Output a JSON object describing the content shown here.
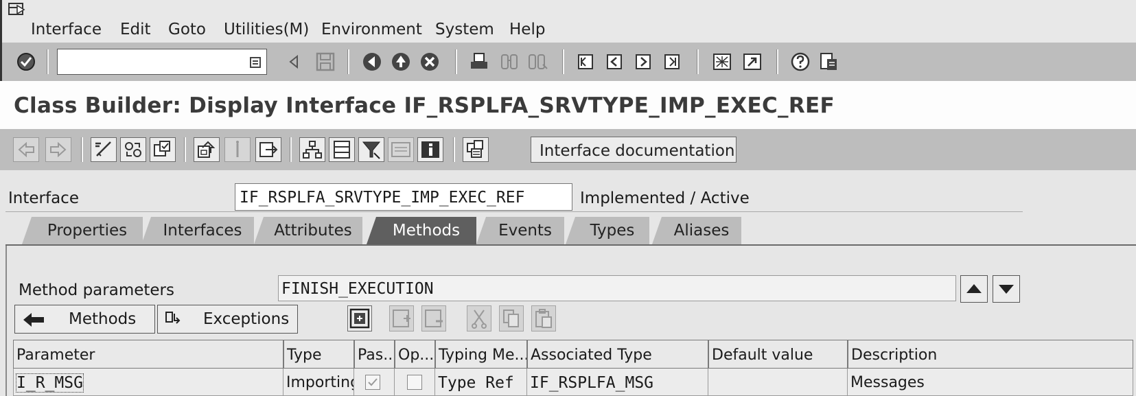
{
  "menubar": {
    "items": [
      {
        "label": "Interface"
      },
      {
        "label": "Edit"
      },
      {
        "label": "Goto"
      },
      {
        "label": "Utilities(M)"
      },
      {
        "label": "Environment"
      },
      {
        "label": "System"
      },
      {
        "label": "Help"
      }
    ]
  },
  "std_toolbar": {
    "command_field": {
      "value": "",
      "placeholder": ""
    },
    "icons": [
      "enter-icon",
      "back-icon",
      "save-icon",
      "exit-icon",
      "up-icon",
      "cancel-icon",
      "print-icon",
      "find-icon",
      "find-next-icon",
      "first-page-icon",
      "previous-page-icon",
      "next-page-icon",
      "last-page-icon",
      "new-session-icon",
      "shortcut-icon",
      "help-icon",
      "layout-icon"
    ]
  },
  "title": "Class Builder: Display Interface IF_RSPLFA_SRVTYPE_IMP_EXEC_REF",
  "app_toolbar": {
    "interface_documentation_label": "Interface documentation"
  },
  "interface": {
    "label": "Interface",
    "value": "IF_RSPLFA_SRVTYPE_IMP_EXEC_REF",
    "status": "Implemented / Active"
  },
  "tabs": [
    {
      "label": "Properties",
      "active": false
    },
    {
      "label": "Interfaces",
      "active": false
    },
    {
      "label": "Attributes",
      "active": false
    },
    {
      "label": "Methods",
      "active": true
    },
    {
      "label": "Events",
      "active": false
    },
    {
      "label": "Types",
      "active": false
    },
    {
      "label": "Aliases",
      "active": false
    }
  ],
  "method_parameters": {
    "label": "Method parameters",
    "value": "FINISH_EXECUTION"
  },
  "buttons": {
    "methods_label": "Methods",
    "exceptions_label": "Exceptions"
  },
  "table": {
    "columns": [
      "Parameter",
      "Type",
      "Pas...",
      "Op...",
      "Typing Me...",
      "Associated Type",
      "Default value",
      "Description"
    ],
    "rows": [
      {
        "parameter": "I_R_MSG",
        "type": "Importing",
        "pass_by_value": true,
        "optional": false,
        "typing_method": "Type Ref",
        "associated_type": "IF_RSPLFA_MSG",
        "default_value": "",
        "description": "Messages"
      }
    ]
  }
}
